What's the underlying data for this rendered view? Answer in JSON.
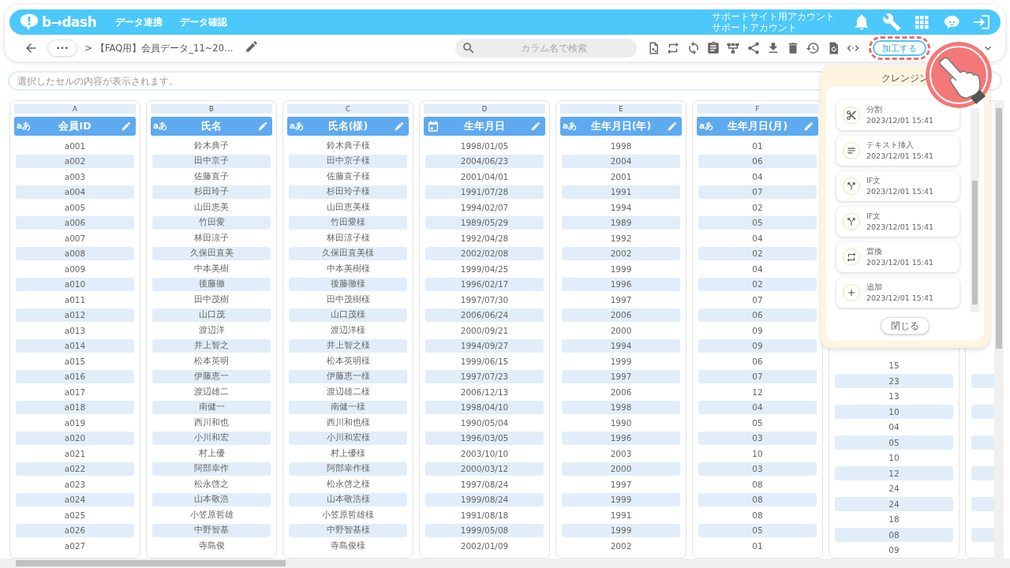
{
  "header": {
    "logo_text": "b→dash",
    "nav": [
      {
        "label": "データ連携"
      },
      {
        "label": "データ確認"
      }
    ],
    "account": [
      "サポートサイト用アカウント",
      "サポートアカウント"
    ]
  },
  "toolbar": {
    "breadcrumb_more": "•••",
    "separator": ">",
    "title": "【FAQ用】会員データ_11~20…",
    "search": {
      "placeholder": "カラム名で検索"
    },
    "action_button": {
      "label": "加工する",
      "highlighted": true
    }
  },
  "cell_view": {
    "placeholder": "選択したセルの内容が表示されます。"
  },
  "table": {
    "columns": [
      {
        "letter": "A",
        "title": "会員ID",
        "kind": "text",
        "type_label": "aあ",
        "cells": [
          "a001",
          "a002",
          "a003",
          "a004",
          "a005",
          "a006",
          "a007",
          "a008",
          "a009",
          "a010",
          "a011",
          "a012",
          "a013",
          "a014",
          "a015",
          "a016",
          "a017",
          "a018",
          "a019",
          "a020",
          "a021",
          "a022",
          "a023",
          "a024",
          "a025",
          "a026",
          "a027"
        ]
      },
      {
        "letter": "B",
        "title": "氏名",
        "kind": "text",
        "type_label": "aあ",
        "cells": [
          "鈴木典子",
          "田中京子",
          "佐藤直子",
          "杉田玲子",
          "山田恵美",
          "竹田愛",
          "林田涼子",
          "久保田直美",
          "中本美樹",
          "後藤徹",
          "田中茂樹",
          "山口茂",
          "渡辺洋",
          "井上智之",
          "松本英明",
          "伊藤恵一",
          "渡辺雄二",
          "南健一",
          "西川和也",
          "小川和宏",
          "村上優",
          "阿部幸作",
          "松永啓之",
          "山本敬浩",
          "小笠原哲雄",
          "中野智基",
          "寺島俊"
        ]
      },
      {
        "letter": "C",
        "title": "氏名(様)",
        "kind": "text",
        "type_label": "aあ",
        "cells": [
          "鈴木典子様",
          "田中京子様",
          "佐藤直子様",
          "杉田玲子様",
          "山田恵美様",
          "竹田愛様",
          "林田涼子様",
          "久保田直美様",
          "中本美樹様",
          "後藤徹様",
          "田中茂樹様",
          "山口茂様",
          "渡辺洋様",
          "井上智之様",
          "松本英明様",
          "伊藤恵一様",
          "渡辺雄二様",
          "南健一様",
          "西川和也様",
          "小川和宏様",
          "村上優様",
          "阿部幸作様",
          "松永啓之様",
          "山本敬浩様",
          "小笠原哲雄様",
          "中野智基様",
          "寺島俊様"
        ]
      },
      {
        "letter": "D",
        "title": "生年月日",
        "kind": "date",
        "cells": [
          "1998/01/05",
          "2004/06/23",
          "2001/04/01",
          "1991/07/28",
          "1994/02/07",
          "1989/05/29",
          "1992/04/28",
          "2002/02/08",
          "1999/04/25",
          "1996/02/17",
          "1997/07/30",
          "2006/06/24",
          "2000/09/21",
          "1994/09/27",
          "1999/06/15",
          "1997/07/23",
          "2006/12/13",
          "1998/04/10",
          "1990/05/04",
          "1996/03/05",
          "2003/10/10",
          "2000/03/12",
          "1997/08/24",
          "1999/08/24",
          "1991/08/18",
          "1999/05/08",
          "2002/01/09"
        ]
      },
      {
        "letter": "E",
        "title": "生年月日(年)",
        "kind": "text",
        "type_label": "aあ",
        "cells": [
          "1998",
          "2004",
          "2001",
          "1991",
          "1994",
          "1989",
          "1992",
          "2002",
          "1999",
          "1996",
          "1997",
          "2006",
          "2000",
          "1994",
          "1999",
          "1997",
          "2006",
          "1998",
          "1990",
          "1996",
          "2003",
          "2000",
          "1997",
          "1999",
          "1991",
          "1999",
          "2002"
        ]
      },
      {
        "letter": "F",
        "title": "生年月日(月)",
        "kind": "text",
        "type_label": "aあ",
        "cells": [
          "01",
          "06",
          "04",
          "07",
          "02",
          "05",
          "04",
          "02",
          "04",
          "02",
          "07",
          "06",
          "09",
          "09",
          "06",
          "07",
          "12",
          "04",
          "05",
          "03",
          "10",
          "03",
          "08",
          "08",
          "08",
          "05",
          "01"
        ]
      }
    ],
    "partial_column": {
      "cells": [
        "15",
        "23",
        "13",
        "10",
        "04",
        "05",
        "10",
        "12",
        "24",
        "24",
        "18",
        "08",
        "09"
      ]
    }
  },
  "cleansing_panel": {
    "title": "クレンジン",
    "steps": [
      {
        "kind": "split",
        "name": "分割",
        "time": "2023/12/01 15:41"
      },
      {
        "kind": "text",
        "name": "テキスト挿入",
        "time": "2023/12/01 15:41"
      },
      {
        "kind": "branch",
        "name": "IF文",
        "time": "2023/12/01 15:41"
      },
      {
        "kind": "branch",
        "name": "IF文",
        "time": "2023/12/01 15:41"
      },
      {
        "kind": "replace",
        "name": "置換",
        "time": "2023/12/01 15:41"
      },
      {
        "kind": "add",
        "name": "追加",
        "time": "2023/12/01 15:41"
      }
    ],
    "close_button": "閉じる"
  }
}
